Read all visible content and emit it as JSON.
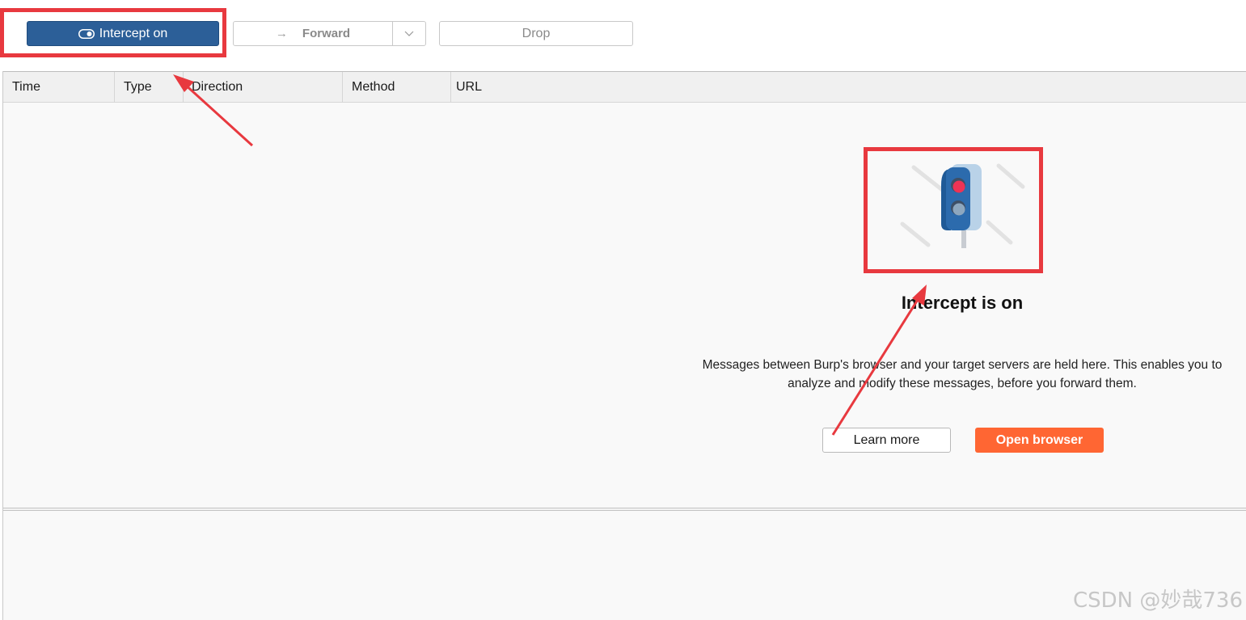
{
  "toolbar": {
    "intercept_label": "Intercept on",
    "forward_label": "Forward",
    "drop_label": "Drop"
  },
  "table": {
    "columns": [
      "Time",
      "Type",
      "Direction",
      "Method",
      "URL"
    ]
  },
  "empty_state": {
    "title": "Intercept is on",
    "description": "Messages between Burp's browser and your target servers are held here. This enables you to\nanalyze and modify these messages, before you forward them.",
    "learn_more_label": "Learn more",
    "open_browser_label": "Open browser"
  },
  "icons": {
    "intercept": "toggle-icon",
    "forward": "arrow-right-icon",
    "forward_menu": "chevron-down-icon",
    "illustration": "traffic-light-icon"
  },
  "colors": {
    "intercept_button": "#2c5f98",
    "open_browser_button": "#ff6633",
    "annotation": "#e8393f"
  },
  "watermark": "CSDN @妙哉736"
}
